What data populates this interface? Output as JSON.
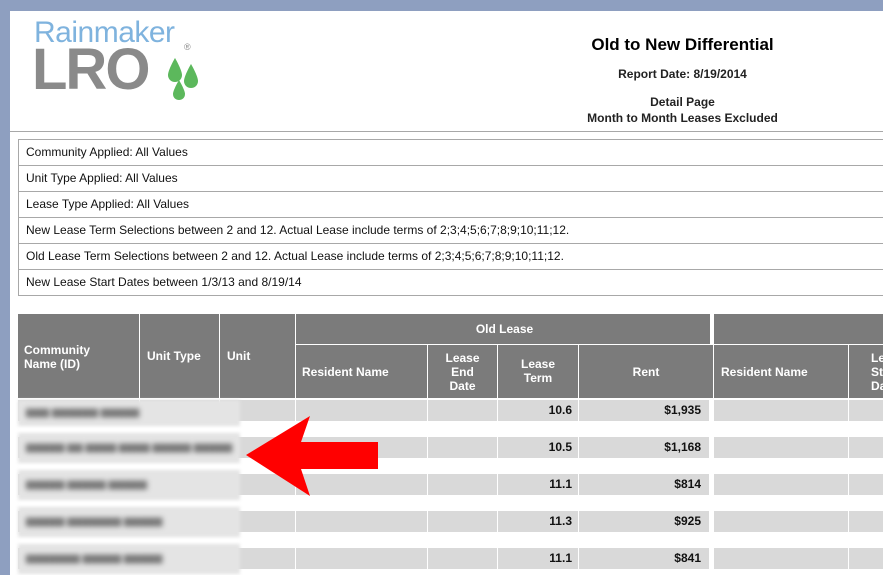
{
  "logo": {
    "line1": "Rainmaker",
    "line2": "LRO",
    "registered": "®",
    "colors": {
      "blue": "#7fb3de",
      "gray": "#8a8a8a",
      "drops": "#5cb85c"
    }
  },
  "report": {
    "title": "Old to New Differential",
    "date": "Report Date: 8/19/2014",
    "subtitle1": "Detail Page",
    "subtitle2": "Month to Month Leases Excluded"
  },
  "filters": [
    "Community Applied: All Values",
    "Unit Type Applied: All Values",
    "Lease Type Applied: All Values",
    "New Lease Term Selections between 2 and 12. Actual Lease include terms of 2;3;4;5;6;7;8;9;10;11;12.",
    "Old Lease Term Selections between 2 and 12. Actual Lease include terms of 2;3;4;5;6;7;8;9;10;11;12.",
    "New Lease Start Dates between 1/3/13 and 8/19/14"
  ],
  "table": {
    "headers": {
      "community_line1": "Community",
      "community_line2": "Name (ID)",
      "unit_type": "Unit Type",
      "unit": "Unit",
      "old_lease_group": "Old Lease",
      "resident_name": "Resident Name",
      "lease_end_line1": "Lease",
      "lease_end_line2": "End",
      "lease_end_line3": "Date",
      "lease_term_line1": "Lease",
      "lease_term_line2": "Term",
      "rent": "Rent",
      "new_resident_name": "Resident Name",
      "new_lease_start_line1": "Lea",
      "new_lease_start_line2": "St",
      "new_lease_start_line3": "Da"
    },
    "rows": [
      {
        "lease_term": "10.6",
        "rent": "$1,935"
      },
      {
        "lease_term": "10.5",
        "rent": "$1,168"
      },
      {
        "lease_term": "11.1",
        "rent": "$814"
      },
      {
        "lease_term": "11.3",
        "rent": "$925"
      },
      {
        "lease_term": "11.1",
        "rent": "$841"
      }
    ]
  },
  "annotation": {
    "arrow_color": "#ff0000"
  }
}
